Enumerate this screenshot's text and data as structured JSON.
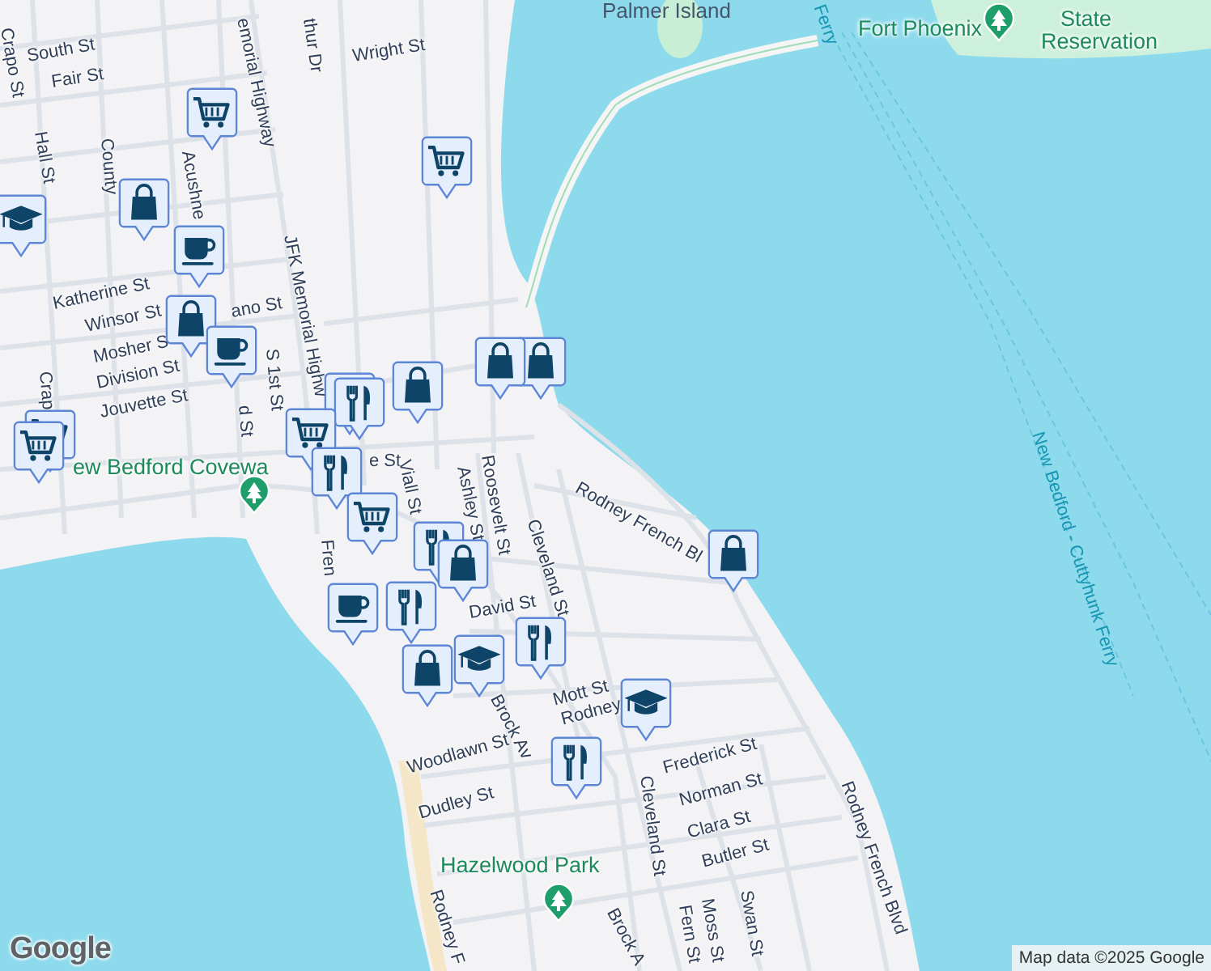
{
  "map": {
    "labels": [
      {
        "text": "South St",
        "kind": "street"
      },
      {
        "text": "Fair St",
        "kind": "street"
      },
      {
        "text": "Crapo St",
        "kind": "street"
      },
      {
        "text": "Hall St",
        "kind": "street"
      },
      {
        "text": "County",
        "kind": "street"
      },
      {
        "text": "Acushne",
        "kind": "street"
      },
      {
        "text": "emorial Highway",
        "kind": "street"
      },
      {
        "text": "thur Dr",
        "kind": "street"
      },
      {
        "text": "Wright St",
        "kind": "street"
      },
      {
        "text": "JFK Memorial Highw",
        "kind": "street"
      },
      {
        "text": "Katherine St",
        "kind": "street"
      },
      {
        "text": "Winsor St",
        "kind": "street"
      },
      {
        "text": "ano St",
        "kind": "street"
      },
      {
        "text": "Mosher S",
        "kind": "street"
      },
      {
        "text": "Division St",
        "kind": "street"
      },
      {
        "text": "Jouvette St",
        "kind": "street"
      },
      {
        "text": "S 1st St",
        "kind": "street"
      },
      {
        "text": "d St",
        "kind": "street"
      },
      {
        "text": "Crap",
        "kind": "street"
      },
      {
        "text": "ew Bedford Covewa",
        "kind": "park"
      },
      {
        "text": "e St",
        "kind": "street"
      },
      {
        "text": "Viall St",
        "kind": "street"
      },
      {
        "text": "Ashley St",
        "kind": "street"
      },
      {
        "text": "Roosevelt St",
        "kind": "street"
      },
      {
        "text": "Rodney French Bl",
        "kind": "street"
      },
      {
        "text": "Cleveland St",
        "kind": "street"
      },
      {
        "text": "Fren",
        "kind": "street"
      },
      {
        "text": "David St",
        "kind": "street"
      },
      {
        "text": "Brock Av",
        "kind": "street"
      },
      {
        "text": "Mott St",
        "kind": "street"
      },
      {
        "text": "Rodney",
        "kind": "street"
      },
      {
        "text": "Woodlawn St",
        "kind": "street"
      },
      {
        "text": "Dudley St",
        "kind": "street"
      },
      {
        "text": "Frederick St",
        "kind": "street"
      },
      {
        "text": "Norman St",
        "kind": "street"
      },
      {
        "text": "Clara St",
        "kind": "street"
      },
      {
        "text": "Butler St",
        "kind": "street"
      },
      {
        "text": "Cleveland St",
        "kind": "street"
      },
      {
        "text": "Moss St",
        "kind": "street"
      },
      {
        "text": "Swan St",
        "kind": "street"
      },
      {
        "text": "Fern St",
        "kind": "street"
      },
      {
        "text": "Brock A",
        "kind": "street"
      },
      {
        "text": "Rodney French Blvd",
        "kind": "street"
      },
      {
        "text": "Rodney F",
        "kind": "street"
      },
      {
        "text": "Hazelwood Park",
        "kind": "park"
      },
      {
        "text": "Palmer Island",
        "kind": "place"
      },
      {
        "text": "Ferry",
        "kind": "ferry"
      },
      {
        "text": "Fort Phoenix",
        "kind": "park"
      },
      {
        "text": "State",
        "kind": "park"
      },
      {
        "text": "Reservation",
        "kind": "park"
      },
      {
        "text": "New Bedford - Cuttyhunk Ferry",
        "kind": "ferry"
      }
    ],
    "pins": [
      {
        "kind": "cart"
      },
      {
        "kind": "cart"
      },
      {
        "kind": "bag"
      },
      {
        "kind": "school"
      },
      {
        "kind": "coffee"
      },
      {
        "kind": "cart"
      },
      {
        "kind": "cart"
      },
      {
        "kind": "bag"
      },
      {
        "kind": "coffee"
      },
      {
        "kind": "bag"
      },
      {
        "kind": "bag"
      },
      {
        "kind": "bag"
      },
      {
        "kind": "food"
      },
      {
        "kind": "food"
      },
      {
        "kind": "cart"
      },
      {
        "kind": "food"
      },
      {
        "kind": "cart"
      },
      {
        "kind": "food"
      },
      {
        "kind": "bag"
      },
      {
        "kind": "coffee"
      },
      {
        "kind": "food"
      },
      {
        "kind": "school"
      },
      {
        "kind": "bag"
      },
      {
        "kind": "food"
      },
      {
        "kind": "school"
      },
      {
        "kind": "food"
      },
      {
        "kind": "bag"
      },
      {
        "kind": "park"
      },
      {
        "kind": "park"
      },
      {
        "kind": "park"
      }
    ],
    "logo": "Google",
    "attribution": "Map data ©2025 Google"
  }
}
